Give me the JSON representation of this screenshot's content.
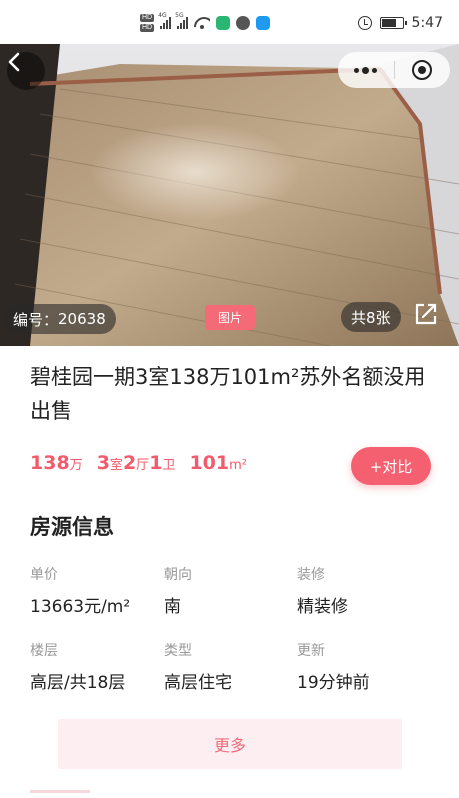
{
  "status_bar": {
    "time": "5:47",
    "hd_badge": "HD",
    "network_types": [
      "4G",
      "5G"
    ],
    "icons": [
      "hd-icon",
      "signal-icon",
      "wifi-icon",
      "app-notification-icon",
      "alarm-icon",
      "battery-icon"
    ]
  },
  "gallery": {
    "listing_code_label": "编号：",
    "listing_code": "20638",
    "tab_label": "图片",
    "photo_count_label": "共8张",
    "icons": [
      "back-icon",
      "more-dots-icon",
      "close-target-icon",
      "share-icon"
    ]
  },
  "listing": {
    "title": "碧桂园一期3室138万101m²苏外名额没用出售",
    "price_value": "138",
    "price_unit": "万",
    "rooms_value": "3",
    "rooms_unit": "室",
    "halls_value": "2",
    "halls_unit": "厅",
    "baths_value": "1",
    "baths_unit": "卫",
    "area_value": "101",
    "area_unit": "m²",
    "compare_button": "+对比"
  },
  "property_info": {
    "section_title": "房源信息",
    "fields": [
      {
        "label": "单价",
        "value": "13663元/m²"
      },
      {
        "label": "朝向",
        "value": "南"
      },
      {
        "label": "装修",
        "value": "精装修"
      },
      {
        "label": "楼层",
        "value": "高层/共18层"
      },
      {
        "label": "类型",
        "value": "高层住宅"
      },
      {
        "label": "更新",
        "value": "19分钟前"
      }
    ],
    "more_button": "更多"
  },
  "colors": {
    "accent": "#f56070",
    "price_text": "#f15b6c",
    "more_button_bg": "#fdeff1"
  }
}
